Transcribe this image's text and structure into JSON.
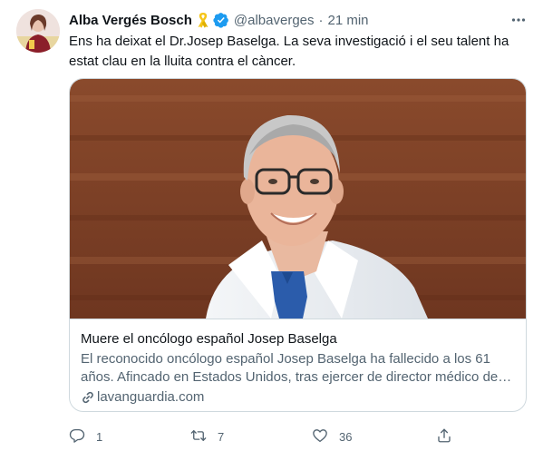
{
  "tweet": {
    "author_name": "Alba Vergés Bosch",
    "handle": "@albaverges",
    "separator": "·",
    "time": "21 min",
    "text": "Ens ha deixat el Dr.Josep Baselga. La seva investigació i el seu talent ha estat clau en la lluita contra el càncer."
  },
  "card": {
    "title": "Muere el oncólogo español Josep Baselga",
    "description": "El reconocido oncólogo español Josep Baselga ha fallecido a los 61 años. Afincado en Estados Unidos, tras ejercer de director médico del ...",
    "domain": "lavanguardia.com"
  },
  "actions": {
    "reply_count": "1",
    "retweet_count": "7",
    "like_count": "36"
  },
  "icons": {
    "ribbon": "yellow-ribbon-icon",
    "verified": "verified-badge-icon",
    "more": "more-icon",
    "link": "link-icon",
    "reply": "reply-icon",
    "retweet": "retweet-icon",
    "like": "like-icon",
    "share": "share-icon"
  },
  "colors": {
    "verified_blue": "#1d9bf0",
    "secondary_text": "#536471",
    "primary_text": "#0f1419",
    "border": "#cfd9de",
    "ribbon_yellow": "#f5c518"
  }
}
